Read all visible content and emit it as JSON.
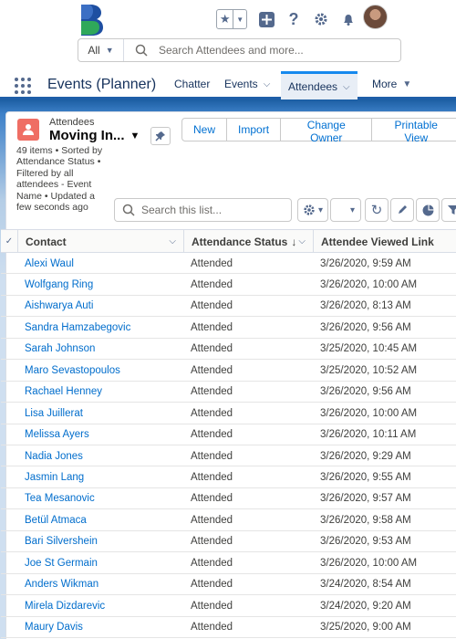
{
  "header": {
    "search_scope": "All",
    "search_placeholder": "Search Attendees and more..."
  },
  "nav": {
    "app_name": "Events (Planner)",
    "items": [
      {
        "label": "Chatter"
      },
      {
        "label": "Events"
      },
      {
        "label": "Attendees"
      },
      {
        "label": "More"
      }
    ]
  },
  "list": {
    "object_label": "Attendees",
    "name": "Moving In...",
    "info": "49 items • Sorted by Attendance Status • Filtered by all attendees - Event Name • Updated a few seconds ago",
    "actions": [
      "New",
      "Import",
      "Change Owner",
      "Printable View"
    ],
    "search_placeholder": "Search this list..."
  },
  "table": {
    "columns": [
      "Contact",
      "Attendance Status",
      "Attendee Viewed Link"
    ],
    "rows": [
      {
        "contact": "Alexi Waul",
        "status": "Attended",
        "viewed": "3/26/2020, 9:59 AM"
      },
      {
        "contact": "Wolfgang Ring",
        "status": "Attended",
        "viewed": "3/26/2020, 10:00 AM"
      },
      {
        "contact": "Aishwarya Auti",
        "status": "Attended",
        "viewed": "3/26/2020, 8:13 AM"
      },
      {
        "contact": "Sandra Hamzabegovic",
        "status": "Attended",
        "viewed": "3/26/2020, 9:56 AM"
      },
      {
        "contact": "Sarah Johnson",
        "status": "Attended",
        "viewed": "3/25/2020, 10:45 AM"
      },
      {
        "contact": "Maro Sevastopoulos",
        "status": "Attended",
        "viewed": "3/25/2020, 10:52 AM"
      },
      {
        "contact": "Rachael Henney",
        "status": "Attended",
        "viewed": "3/26/2020, 9:56 AM"
      },
      {
        "contact": "Lisa Juillerat",
        "status": "Attended",
        "viewed": "3/26/2020, 10:00 AM"
      },
      {
        "contact": "Melissa Ayers",
        "status": "Attended",
        "viewed": "3/26/2020, 10:11 AM"
      },
      {
        "contact": "Nadia Jones",
        "status": "Attended",
        "viewed": "3/26/2020, 9:29 AM"
      },
      {
        "contact": "Jasmin Lang",
        "status": "Attended",
        "viewed": "3/26/2020, 9:55 AM"
      },
      {
        "contact": "Tea Mesanovic",
        "status": "Attended",
        "viewed": "3/26/2020, 9:57 AM"
      },
      {
        "contact": "Betül Atmaca",
        "status": "Attended",
        "viewed": "3/26/2020, 9:58 AM"
      },
      {
        "contact": "Bari Silvershein",
        "status": "Attended",
        "viewed": "3/26/2020, 9:53 AM"
      },
      {
        "contact": "Joe St Germain",
        "status": "Attended",
        "viewed": "3/26/2020, 10:00 AM"
      },
      {
        "contact": "Anders Wikman",
        "status": "Attended",
        "viewed": "3/24/2020, 8:54 AM"
      },
      {
        "contact": "Mirela Dizdarevic",
        "status": "Attended",
        "viewed": "3/24/2020, 9:20 AM"
      },
      {
        "contact": "Maury Davis",
        "status": "Attended",
        "viewed": "3/25/2020, 9:00 AM"
      }
    ]
  }
}
